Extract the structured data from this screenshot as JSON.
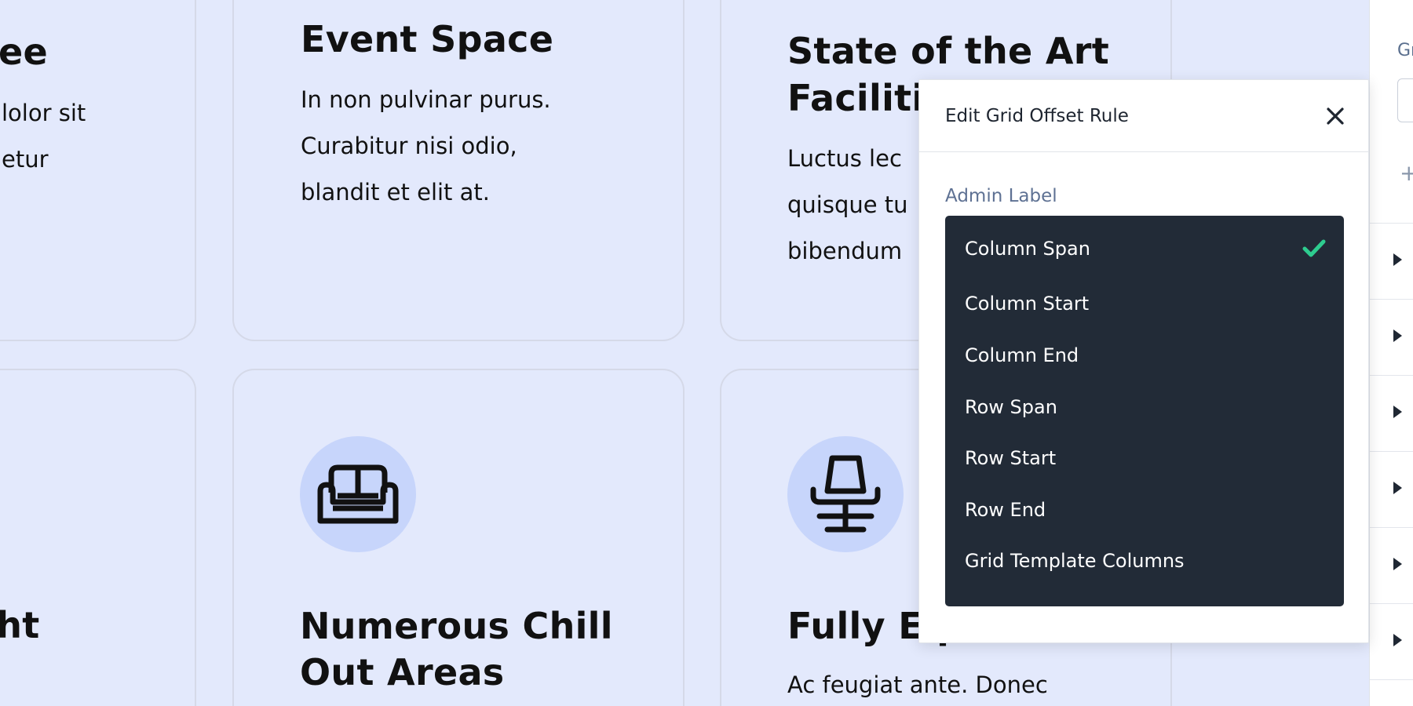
{
  "cards": {
    "top_left": {
      "title": "ee",
      "lines": [
        "lolor sit",
        "etur"
      ]
    },
    "event_space": {
      "title": "Event Space",
      "lines": [
        "In non pulvinar purus.",
        "Curabitur nisi odio,",
        "blandit et elit at."
      ]
    },
    "state_of_art": {
      "title_line1": "State of the Art",
      "title_line2": "Faciliti",
      "lines": [
        "Luctus lec",
        "quisque tu",
        "bibendum"
      ]
    },
    "bottom_left": {
      "title": "ght"
    },
    "chill_out": {
      "icon": "sofa-icon",
      "title_line1": "Numerous Chill",
      "title_line2": "Out Areas"
    },
    "fully_equipped": {
      "icon": "office-chair-icon",
      "title": "Fully Eq",
      "lines": [
        "Ac feugiat ante. Donec"
      ]
    }
  },
  "sidebar": {
    "label": "Gr",
    "plus_icon": "plus-icon",
    "row_count": 6
  },
  "modal": {
    "title": "Edit Grid Offset Rule",
    "close_icon": "close-icon",
    "field_label": "Admin Label",
    "dropdown": {
      "selected": "Column Span",
      "options": [
        "Column Span",
        "Column Start",
        "Column End",
        "Row Span",
        "Row Start",
        "Row End",
        "Grid Template Columns"
      ]
    }
  },
  "colors": {
    "page_bg": "#e3e9fc",
    "icon_circle": "#c7d5fb",
    "dropdown_bg": "#222b37",
    "check": "#2ecc8f",
    "label_blue": "#5e7193"
  }
}
